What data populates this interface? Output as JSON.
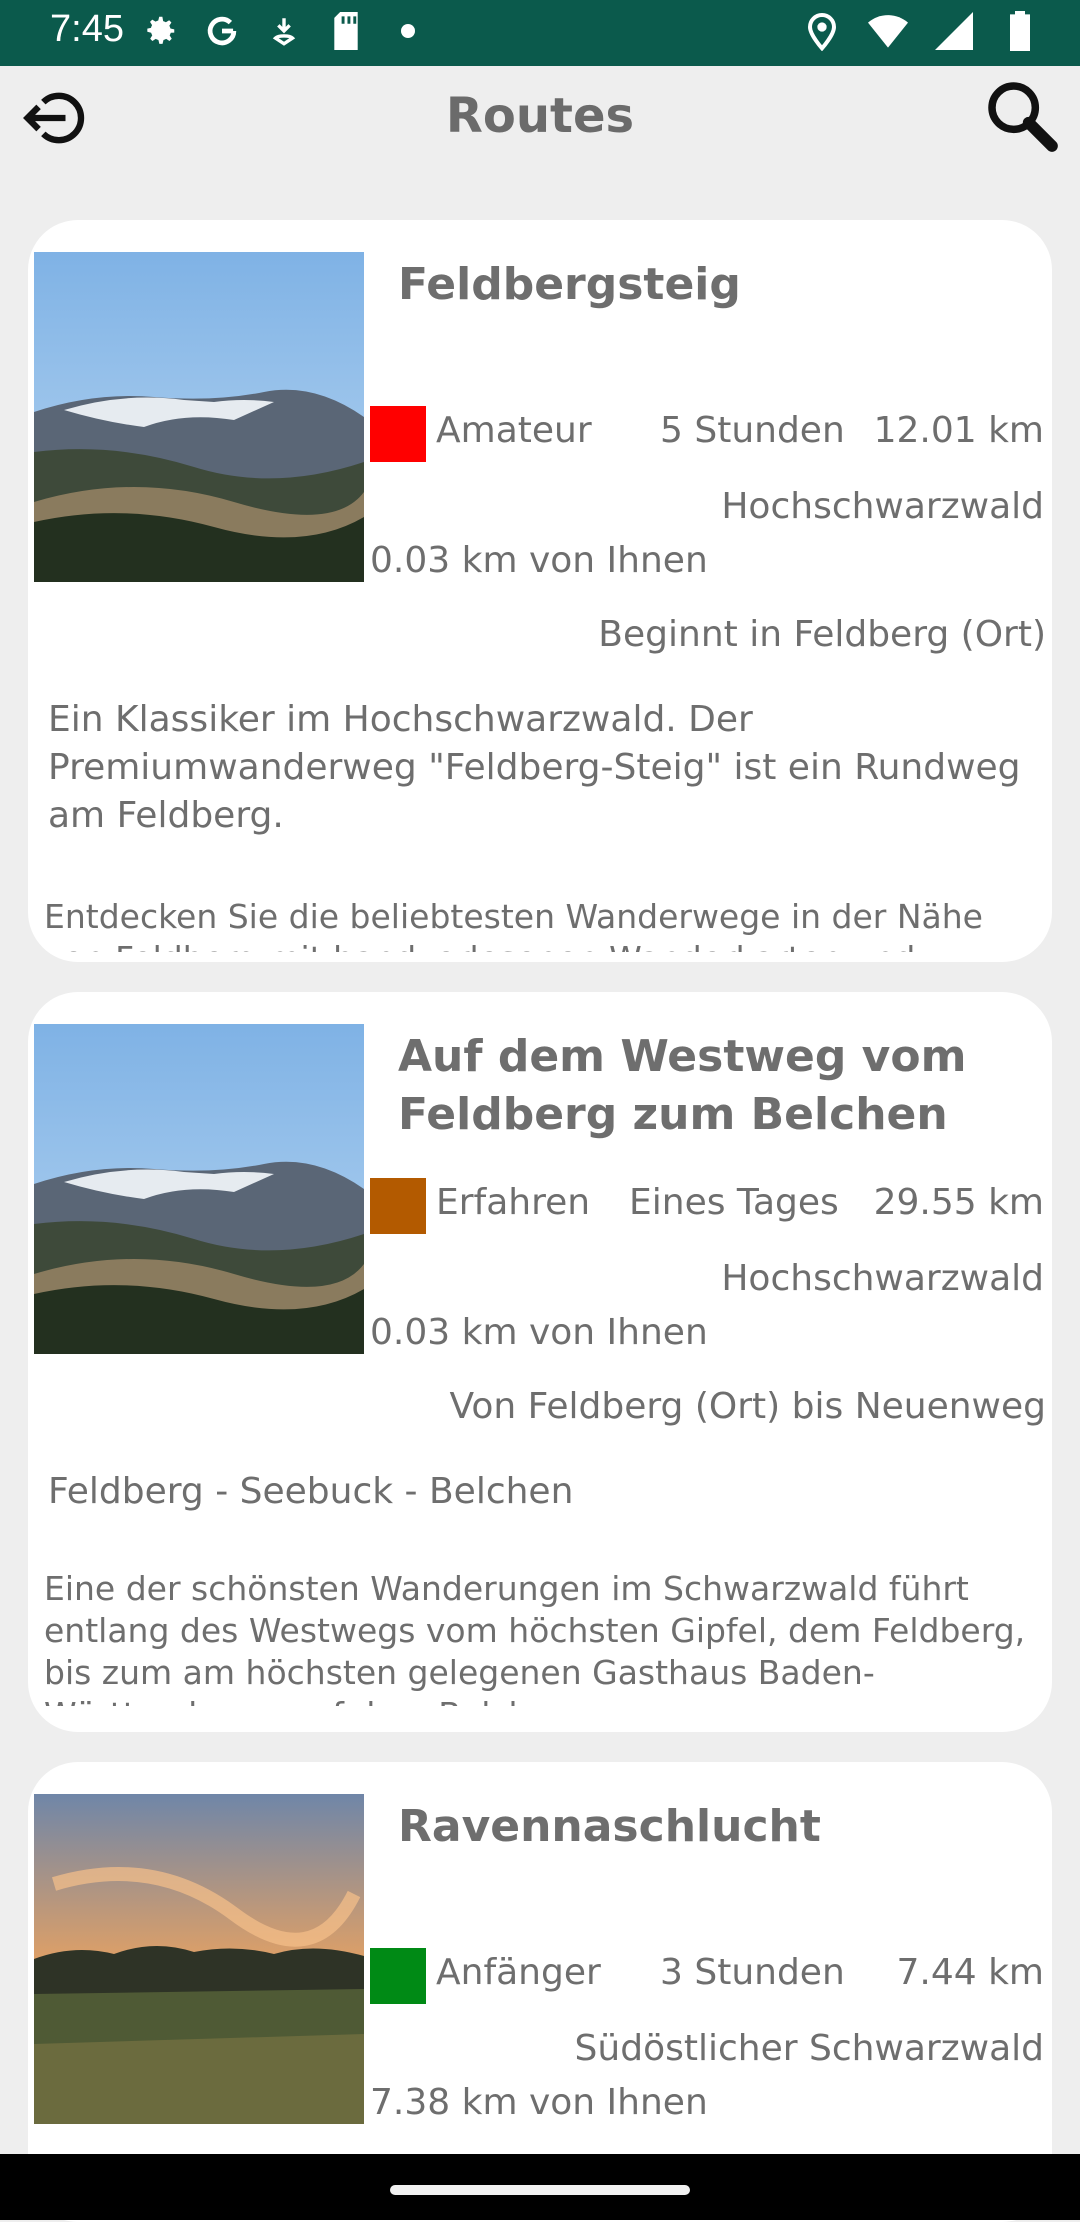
{
  "status_bar": {
    "time": "7:45",
    "left_icons": [
      "gear-icon",
      "google-icon",
      "download-icon",
      "sd-card-icon",
      "dot-icon"
    ],
    "right_icons": [
      "location-icon",
      "wifi-icon",
      "signal-icon",
      "battery-icon"
    ],
    "color": "#0b5a4c"
  },
  "top_bar": {
    "title": "Routes",
    "left_icon": "logout-icon",
    "right_icon": "search-icon"
  },
  "routes": [
    {
      "title": "Feldbergsteig",
      "difficulty": "Amateur",
      "difficulty_color": "#ff0000",
      "duration": "5 Stunden",
      "distance": "12.01 km",
      "region": "Hochschwarzwald",
      "distance_from_you": "0.03 km von Ihnen",
      "start": "Beginnt in Feldberg (Ort)",
      "short_description": "Ein Klassiker im Hochschwarzwald. Der Premiumwanderweg \"Feldberg-Steig\" ist ein Rundweg am Feldberg.",
      "long_description": "Entdecken Sie die beliebtesten Wanderwege in der Nähe von Feldberg mit handverlesenen Wanderkarten und"
    },
    {
      "title": "Auf dem Westweg vom Feldberg zum Belchen",
      "difficulty": "Erfahren",
      "difficulty_color": "#b35a00",
      "duration": "Eines Tages",
      "distance": "29.55 km",
      "region": "Hochschwarzwald",
      "distance_from_you": "0.03 km von Ihnen",
      "start": "Von Feldberg (Ort) bis Neuenweg",
      "short_description": "Feldberg - Seebuck - Belchen",
      "long_description": "Eine der schönsten Wanderungen im Schwarzwald führt entlang des Westwegs vom höchsten Gipfel, dem Feldberg, bis zum am höchsten gelegenen Gasthaus Baden-Württembergs auf dem Belchen"
    },
    {
      "title": "Ravennaschlucht",
      "difficulty": "Anfänger",
      "difficulty_color": "#008a15",
      "duration": "3 Stunden",
      "distance": "7.44 km",
      "region": "Südöstlicher Schwarzwald",
      "distance_from_you": "7.38 km von Ihnen"
    }
  ]
}
